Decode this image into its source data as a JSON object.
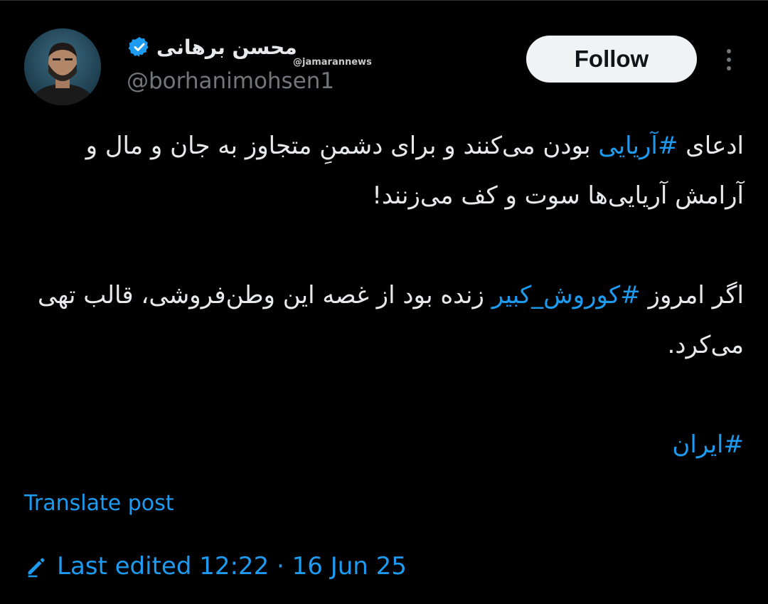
{
  "author": {
    "display_name": "محسن برهانی",
    "handle": "@borhanimohsen1",
    "verified": true,
    "avatar_icon": "avatar-photo"
  },
  "watermark": "@jamarannews",
  "follow_button": {
    "label": "Follow"
  },
  "more_button": {
    "icon": "more-vertical-icon"
  },
  "tweet": {
    "paragraph1": {
      "before": "ادعای ",
      "hashtag": "#آریایی",
      "after": " بودن می‌کنند و برای دشمنِ متجاوز به جان و مال و آرامش آریایی‌ها سوت و کف می‌زنند!"
    },
    "paragraph2": {
      "before": "اگر امروز ",
      "hashtag": "#کوروش_کبیر",
      "after": " زنده بود از غصه این وطن‌فروشی، قالب تهی می‌کرد."
    },
    "paragraph3": {
      "hashtag": "#ایران"
    }
  },
  "translate_link": "Translate post",
  "edited": {
    "label": "Last edited 12:22 · 16 Jun 25",
    "icon": "edit-pencil-icon"
  },
  "colors": {
    "background": "#000000",
    "text": "#e7e9ea",
    "secondary_text": "#71767b",
    "link": "#1d9bf0",
    "follow_bg": "#eff3f4"
  }
}
